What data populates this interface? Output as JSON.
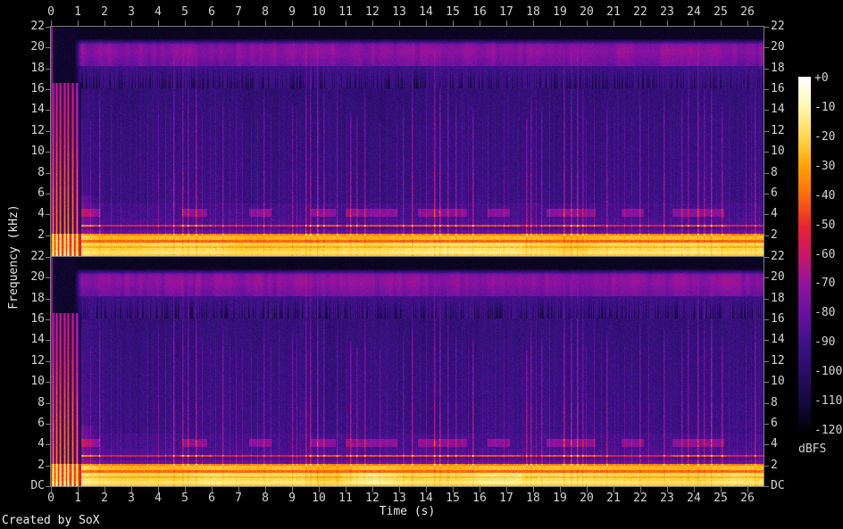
{
  "figure": {
    "credit": "Created by SoX",
    "x_axis_title": "Time (s)",
    "y_axis_title": "Frequency (kHz)",
    "colorbar_unit": "dBFS",
    "colors": {
      "background": "#000000",
      "axis_line": "#7d7d7d",
      "tick_label": "#d4d4d4",
      "title_text": "#e8e8e8"
    }
  },
  "chart_data": {
    "type": "heatmap",
    "subtype": "stereo-audio-spectrogram",
    "tool": "SoX",
    "x_axis": {
      "label": "Time (s)",
      "min_s": 0,
      "max_s": 26.6,
      "tick_labels": [
        "0",
        "1",
        "2",
        "3",
        "4",
        "5",
        "6",
        "7",
        "8",
        "9",
        "10",
        "11",
        "12",
        "13",
        "14",
        "15",
        "16",
        "17",
        "18",
        "19",
        "20",
        "21",
        "22",
        "23",
        "24",
        "25",
        "26"
      ]
    },
    "y_axis": {
      "label": "Frequency (kHz)",
      "min_label": "DC",
      "max_khz": 22,
      "tick_step_khz": 2,
      "top_panel_tick_labels": [
        "22",
        "20",
        "18",
        "16",
        "14",
        "12",
        "10",
        "8",
        "6",
        "4",
        "2"
      ],
      "bottom_panel_tick_labels": [
        "22",
        "20",
        "18",
        "16",
        "14",
        "12",
        "10",
        "8",
        "6",
        "4",
        "2",
        "DC"
      ]
    },
    "colorbar": {
      "label": "dBFS",
      "min_dbfs": -120,
      "max_dbfs": 0,
      "tick_labels": [
        "+0",
        "-10",
        "-20",
        "-30",
        "-40",
        "-50",
        "-60",
        "-70",
        "-80",
        "-90",
        "-100",
        "-110",
        "-120"
      ],
      "palette_stops": [
        [
          0.0,
          "#000000"
        ],
        [
          0.083,
          "#130838"
        ],
        [
          0.167,
          "#270d60"
        ],
        [
          0.25,
          "#3c1186"
        ],
        [
          0.333,
          "#65119c"
        ],
        [
          0.417,
          "#8f13a0"
        ],
        [
          0.5,
          "#c8156c"
        ],
        [
          0.583,
          "#ea2430"
        ],
        [
          0.667,
          "#fb6b0a"
        ],
        [
          0.75,
          "#ffa402"
        ],
        [
          0.833,
          "#ffd84f"
        ],
        [
          0.917,
          "#fff8b0"
        ],
        [
          1.0,
          "#ffffff"
        ]
      ]
    },
    "channels": [
      {
        "name": "channel-1-top",
        "noise_seed": 101
      },
      {
        "name": "channel-2-bottom",
        "noise_seed": 202
      }
    ],
    "beat_seed": 77,
    "features": {
      "duration_s": 26.6,
      "intro": {
        "end_s": 1.12,
        "hit_times_s": [
          0.07,
          0.2,
          0.34,
          0.5,
          0.63,
          0.8,
          0.96
        ],
        "hit_max_khz": 16.6
      },
      "leading_full_height_line": true,
      "bass_band_top_khz": 2.1,
      "bright_line_khz": 2.0,
      "red_line_khz": 2.9,
      "red_line_bright_ranges_s": [
        [
          0.9,
          1.8
        ],
        [
          4.8,
          6.0
        ],
        [
          9.6,
          10.8
        ],
        [
          11.0,
          17.5
        ],
        [
          18.4,
          20.5
        ],
        [
          23.2,
          25.2
        ]
      ],
      "midband_khz": [
        3.75,
        4.55
      ],
      "midband_ranges_s": [
        [
          1.05,
          1.8
        ],
        [
          4.9,
          5.8
        ],
        [
          7.4,
          8.2
        ],
        [
          9.7,
          10.6
        ],
        [
          11.0,
          12.9
        ],
        [
          13.7,
          15.5
        ],
        [
          16.3,
          17.1
        ],
        [
          18.5,
          20.3
        ],
        [
          21.3,
          22.1
        ],
        [
          23.2,
          25.1
        ]
      ],
      "hiss_notch_band_khz": [
        16.1,
        18.3
      ],
      "haze_band_khz": [
        18.3,
        20.5
      ],
      "cutoff_khz": 20.9,
      "beat_min_gap_s": 0.13,
      "accent_times_s": [
        5.0,
        9.8,
        14.6,
        19.4,
        24.2
      ],
      "bass_bright_range_s": [
        10.8,
        17.6
      ]
    }
  }
}
